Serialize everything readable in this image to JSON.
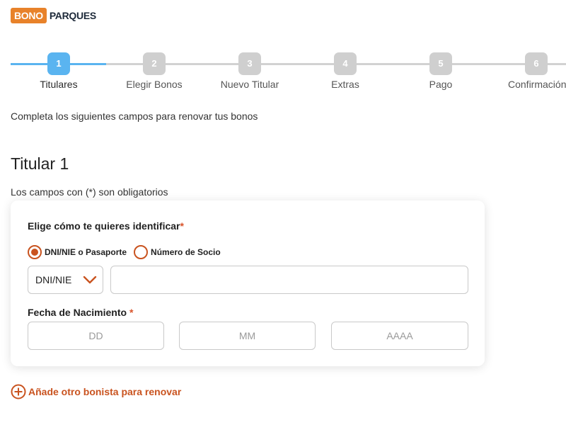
{
  "logo": {
    "part1": "BONO",
    "part2": "PARQUES"
  },
  "stepper": {
    "steps": [
      {
        "number": "1",
        "label": "Titulares",
        "active": true
      },
      {
        "number": "2",
        "label": "Elegir Bonos"
      },
      {
        "number": "3",
        "label": "Nuevo Titular"
      },
      {
        "number": "4",
        "label": "Extras"
      },
      {
        "number": "5",
        "label": "Pago"
      },
      {
        "number": "6",
        "label": "Confirmación"
      }
    ]
  },
  "intro": "Completa los siguientes campos para renovar tus bonos",
  "titular": {
    "heading": "Titular 1",
    "required_note": "Los campos con (*) son obligatorios"
  },
  "form": {
    "identify_label": "Elige cómo te quieres identificar",
    "asterisk": "*",
    "radio_options": [
      {
        "label": "DNI/NIE o Pasaporte",
        "checked": true
      },
      {
        "label": "Número de Socio",
        "checked": false
      }
    ],
    "doc_type_value": "DNI/NIE",
    "doc_number_value": "",
    "birth_label": "Fecha de Nacimiento",
    "birth_asterisk": "*",
    "day_placeholder": "DD",
    "month_placeholder": "MM",
    "year_placeholder": "AAAA"
  },
  "add_link": "Añade otro bonista para renovar",
  "colors": {
    "accent": "#c9531f",
    "active_step": "#5ab4f0",
    "brand_orange": "#e8822a"
  }
}
